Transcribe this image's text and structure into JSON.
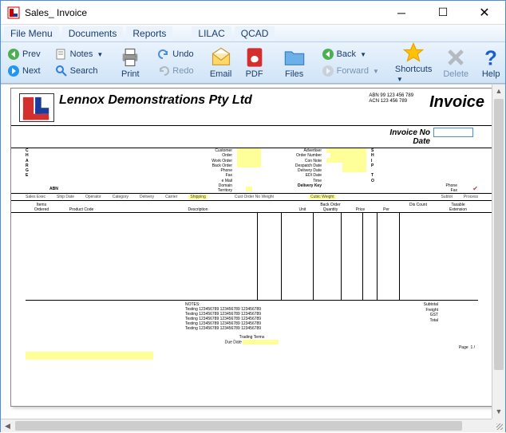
{
  "window": {
    "title": "Sales_ Invoice"
  },
  "menu": {
    "file": "File Menu",
    "documents": "Documents",
    "reports": "Reports",
    "lilac": "LILAC",
    "qcad": "QCAD"
  },
  "toolbar": {
    "prev": "Prev",
    "next": "Next",
    "notes": "Notes",
    "search": "Search",
    "print": "Print",
    "undo": "Undo",
    "redo": "Redo",
    "email": "Email",
    "pdf": "PDF",
    "files": "Files",
    "back": "Back",
    "forward": "Forward",
    "shortcuts": "Shortcuts",
    "delete": "Delete",
    "help": "Help"
  },
  "invoice": {
    "company": "Lennox Demonstrations Pty Ltd",
    "abn1": "ABN 99 123 456 789",
    "abn2": "ACN 123 456 789",
    "title": "Invoice",
    "meta": {
      "invoice_no_label": "Invoice No",
      "date_label": "Date"
    },
    "charge_letters": [
      "C",
      "H",
      "A",
      "R",
      "G",
      "E"
    ],
    "ship_letters": [
      "S",
      "H",
      "I",
      "P",
      "",
      "T",
      "O"
    ],
    "col1": [
      "Customer",
      "Order",
      "Work Order",
      "Back Order",
      "Phone",
      "Fax",
      "e Mail",
      "Domain",
      "Territory"
    ],
    "col1_abn": "ABN",
    "col2": [
      "Advertiser",
      "Order Number",
      "Con Note",
      "Despatch Date",
      "Delivery Date",
      "EDI Date",
      "Time",
      "Delivery Key"
    ],
    "col2b": [
      "Cust Order No",
      "Weight"
    ],
    "ship_labels": [
      "Phone",
      "Fax"
    ],
    "summary": [
      "Sales Exec",
      "Ship Date",
      "Operator",
      "Category",
      "Delivery",
      "Carrier",
      "Shipping",
      "Cubic Weight",
      "Subtot",
      "Process"
    ],
    "table": {
      "items": "Items",
      "ordered": "Ordered",
      "product_code": "Product Code",
      "description": "Description",
      "unit": "Unit",
      "back_order": "Back Order",
      "quantity": "Quantity",
      "price": "Price",
      "dis_count": "Dis Count",
      "per": "Per",
      "taxable": "Taxable",
      "extension": "Extension"
    },
    "notes_hdr": "NOTES:",
    "notes": [
      "Testing 123456789 123456789 123456789",
      "Testing 123456789 123456789 123456789",
      "Testing 123456789 123456789 123456789",
      "Testing 123456789 123456789 123456789",
      "Testing 123456789 123456789 123456789"
    ],
    "totals": {
      "subtotal": "Subtotal",
      "freight": "Freight",
      "gst": "GST",
      "total": "Total"
    },
    "trading_terms": "Trading Terms",
    "due_date": "Due Date",
    "page_label": "Page",
    "page_cur": "1",
    "page_sep": "/"
  }
}
